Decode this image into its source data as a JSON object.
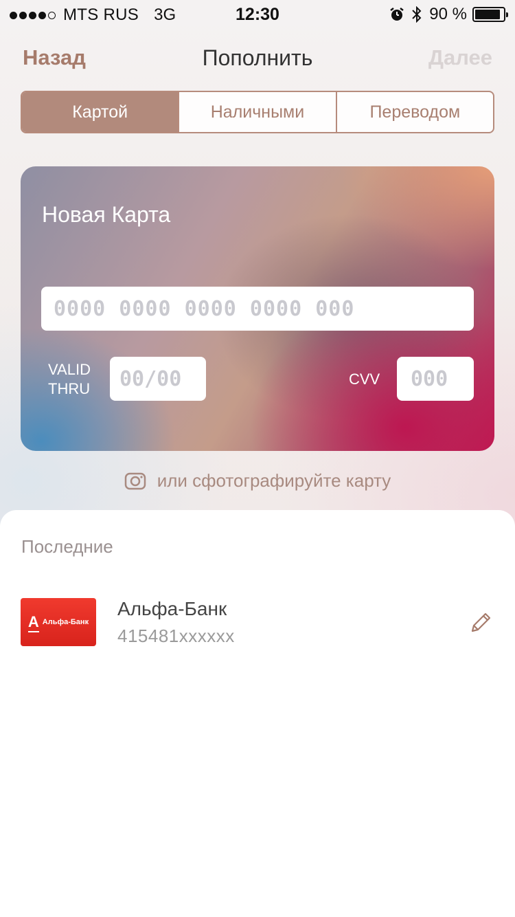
{
  "status_bar": {
    "carrier": "MTS RUS",
    "network": "3G",
    "time": "12:30",
    "battery": "90 %",
    "battery_level": 0.9,
    "icons": [
      "signal-dots-icon",
      "alarm-icon",
      "bluetooth-icon",
      "battery-icon"
    ]
  },
  "nav": {
    "back_label": "Назад",
    "title": "Пополнить",
    "next_label": "Далее"
  },
  "tabs": [
    {
      "label": "Картой",
      "active": true
    },
    {
      "label": "Наличными",
      "active": false
    },
    {
      "label": "Переводом",
      "active": false
    }
  ],
  "card": {
    "title": "Новая Карта",
    "number_placeholder": "0000 0000 0000 0000 000",
    "valid_label_line1": "VALID",
    "valid_label_line2": "THRU",
    "valid_placeholder": "00/00",
    "cvv_label": "CVV",
    "cvv_placeholder": "000"
  },
  "photo_link": {
    "label": "или сфотографируйте карту",
    "icon": "camera-icon"
  },
  "recent": {
    "title": "Последние",
    "items": [
      {
        "bank_name": "Альфа-Банк",
        "card_number": "415481xxxxxx",
        "logo_letter": "A",
        "logo_text": "Альфа-Банк",
        "logo_color": "#ef3124",
        "action_icon": "pencil-icon"
      }
    ]
  },
  "colors": {
    "accent": "#a67b6b",
    "segment_active": "#b28a7c",
    "disabled": "#d9d3d3"
  }
}
